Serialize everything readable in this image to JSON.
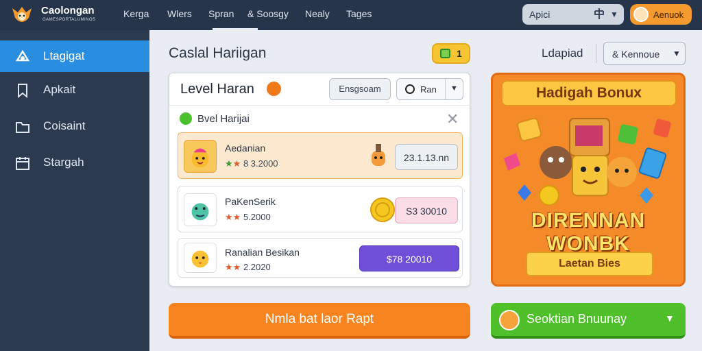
{
  "app": {
    "brand": "Caolongan",
    "brand_sub": "GAMESPORTALUMINOS"
  },
  "nav": {
    "items": [
      "Kerga",
      "Wlers",
      "Spran",
      "& Soosgy",
      "Nealy",
      "Tages"
    ]
  },
  "search": {
    "label": "Apici"
  },
  "account": {
    "label": "Aenuok"
  },
  "sidebar": {
    "items": [
      {
        "label": "Ltagigat",
        "icon": "game-icon",
        "active": true
      },
      {
        "label": "Apkait",
        "icon": "bookmark-icon",
        "active": false
      },
      {
        "label": "Coisaint",
        "icon": "folder-icon",
        "active": false
      },
      {
        "label": "Stargah",
        "icon": "calendar-icon",
        "active": false
      }
    ]
  },
  "main": {
    "title": "Caslal Hariigan",
    "badge_count": "1",
    "upload_label": "Ldapiad",
    "kennoue_label": "& Kennoue"
  },
  "panel": {
    "title": "Level Haran",
    "btn_gray": "Ensgsoam",
    "btn_run": "Ran",
    "filter_label": "Bvel Harijai",
    "rows": [
      {
        "name": "Aedanian",
        "stars": "★★",
        "rating": "8 3.2000",
        "value": "23.1.13.nn"
      },
      {
        "name": "PaKenSerik",
        "stars": "★★",
        "rating": "5.2000",
        "value": "S3 30010"
      },
      {
        "name": "Ranalian Besikan",
        "stars": "★★",
        "rating": "2.2020",
        "value": "$78 20010"
      }
    ]
  },
  "cta": {
    "label": "Nmla bat laor Rapt"
  },
  "promo": {
    "title": "Hadigah Bonux",
    "big_text": "DIRENNAN WONBK",
    "button": "Laetan Bies"
  },
  "green_btn": {
    "label": "Seoktian Bnuunay"
  },
  "colors": {
    "topbar": "#26354a",
    "sidebar": "#2c3a4f",
    "accent_blue": "#2a8ee0",
    "orange": "#f7841f",
    "green": "#4fbf2a",
    "purple": "#6f4fd8"
  }
}
